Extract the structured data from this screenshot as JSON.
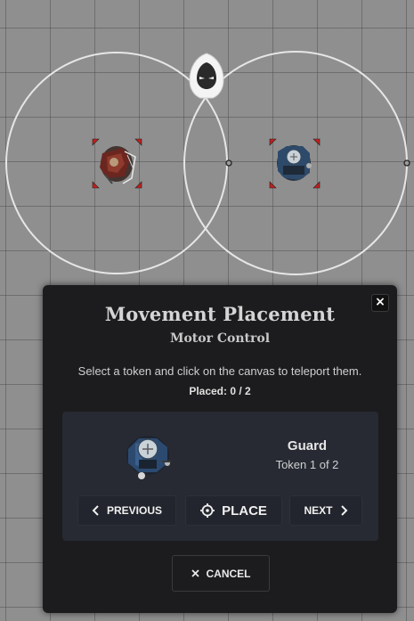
{
  "dialog": {
    "title": "Movement Placement",
    "subtitle": "Motor Control",
    "instruction": "Select a token and click on the canvas to teleport them.",
    "placed_status": "Placed: 0 / 2",
    "close_label": "×",
    "current_token": {
      "name": "Guard",
      "counter": "Token 1 of 2"
    },
    "buttons": {
      "previous": "PREVIOUS",
      "place": "PLACE",
      "next": "NEXT",
      "cancel": "CANCEL"
    }
  },
  "canvas": {
    "tokens": [
      {
        "name": "red-cloaked-rogue-token",
        "selected": true
      },
      {
        "name": "guard-token",
        "selected": true
      }
    ],
    "colors": {
      "grid_background": "#8f8f8f",
      "range_ring": "#e6e6e6",
      "selection_corner": "#c0201e"
    }
  },
  "icons": {
    "previous": "chevron-left-icon",
    "place": "crosshair-icon",
    "next": "chevron-right-icon",
    "cancel": "close-icon",
    "hooded_figure": "hooded-figure-icon"
  }
}
